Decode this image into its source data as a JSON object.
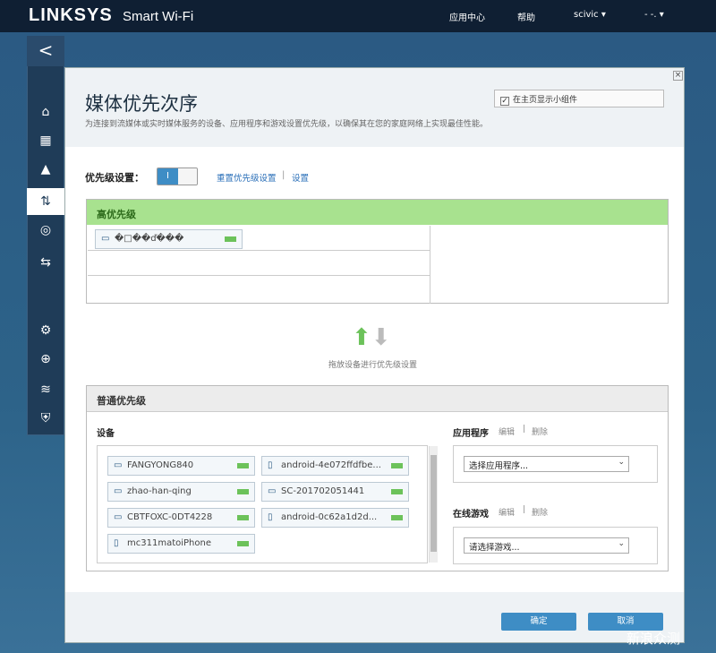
{
  "app": {
    "logo": "LINKSYS",
    "logo_sub": "Smart Wi-Fi"
  },
  "topnav": {
    "app_center": "应用中心",
    "help": "帮助",
    "user": "scivic",
    "extra": "- -."
  },
  "sidebar": {
    "back": "<"
  },
  "modal": {
    "title": "媒体优先次序",
    "description": "为连接到流媒体或实时媒体服务的设备、应用程序和游戏设置优先级，以确保其在您的家庭网络上实现最佳性能。",
    "show_widget_label": "在主页显示小组件",
    "show_widget_checked": true,
    "priority_label": "优先级设置：",
    "toggle_on": "I",
    "reset_link": "重置优先级设置",
    "settings_link": "设置",
    "high_priority": {
      "title": "高优先级",
      "devices": [
        {
          "name": "�□��ď���"
        }
      ]
    },
    "drag_hint": "拖放设备进行优先级设置",
    "normal_priority": {
      "title": "普通优先级",
      "devices_label": "设备",
      "devices": [
        {
          "name": "FANGYONG840",
          "icon": "computer-icon"
        },
        {
          "name": "android-4e072ffdfbe...",
          "icon": "phone-icon"
        },
        {
          "name": "zhao-han-qing",
          "icon": "computer-icon"
        },
        {
          "name": "SC-201702051441",
          "icon": "computer-icon"
        },
        {
          "name": "CBTFOXC-0DT4228",
          "icon": "computer-icon"
        },
        {
          "name": "android-0c62a1d2d...",
          "icon": "phone-icon"
        },
        {
          "name": "mc311matoiPhone",
          "icon": "phone-icon"
        }
      ],
      "apps_label": "应用程序",
      "apps_edit": "编辑",
      "apps_delete": "删除",
      "apps_select": "选择应用程序...",
      "games_label": "在线游戏",
      "games_edit": "编辑",
      "games_delete": "删除",
      "games_select": "请选择游戏..."
    },
    "ok": "确定",
    "cancel": "取消"
  },
  "watermark": "新浪众测",
  "colors": {
    "accent": "#3e8dc5",
    "high_priority": "#a8e28f",
    "nav": "#0f1f33"
  }
}
